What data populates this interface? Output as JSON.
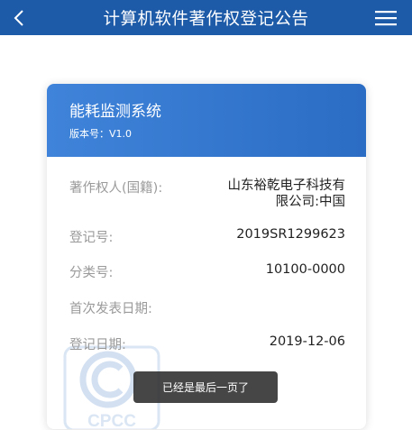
{
  "header": {
    "title": "计算机软件著作权登记公告",
    "back_icon": "chevron-left-icon",
    "menu_icon": "hamburger-menu-icon",
    "color": "#1d5aa8"
  },
  "card": {
    "software_name": "能耗监测系统",
    "version": "版本号：V1.0",
    "head_color": "#3a7ed5",
    "fields": [
      {
        "label": "著作权人(国籍):",
        "value": "山东裕乾电子科技有限公司:中国"
      },
      {
        "label": "登记号:",
        "value": "2019SR1299623"
      },
      {
        "label": "分类号:",
        "value": "10100-0000"
      },
      {
        "label": "首次发表日期:",
        "value": ""
      },
      {
        "label": "登记日期:",
        "value": "2019-12-06"
      }
    ],
    "watermark_text": "CPCC"
  },
  "toast": {
    "text": "已经是最后一页了"
  }
}
